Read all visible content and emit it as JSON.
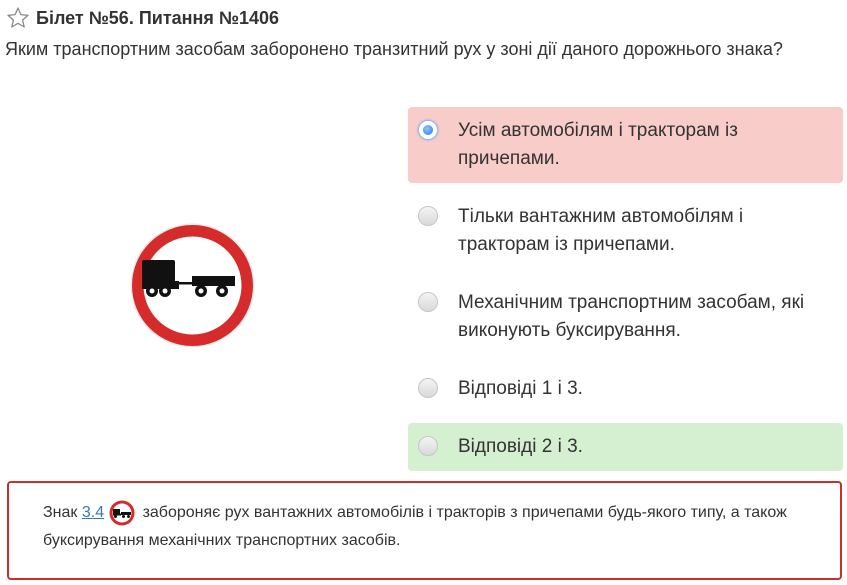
{
  "header": {
    "title": "Білет №56. Питання №1406"
  },
  "question": "Яким транспортним засобам заборонено транзитний рух у зоні дії даного дорожнього знака?",
  "answers": [
    {
      "text": "Усім автомобілям і тракторам із причепами.",
      "state": "wrong",
      "selected": true
    },
    {
      "text": "Тільки вантажним автомобілям і тракторам із причепами.",
      "state": "neutral",
      "selected": false
    },
    {
      "text": "Механічним транспортним засобам, які виконують буксирування.",
      "state": "neutral",
      "selected": false
    },
    {
      "text": "Відповіді 1 і 3.",
      "state": "neutral",
      "selected": false
    },
    {
      "text": "Відповіді 2 і 3.",
      "state": "right",
      "selected": false
    }
  ],
  "explanation": {
    "prefix": "Знак",
    "link_text": "3.4",
    "suffix": "забороняє рух вантажних автомобілів і тракторів з причепами будь-якого типу, а також буксирування механічних транспортних засобів."
  },
  "colors": {
    "wrong_bg": "#f8ccc8",
    "right_bg": "#d4f0d0",
    "border_red": "#c9302c",
    "link": "#337ab7",
    "sign_red": "#d52b2b"
  },
  "icons": {
    "favorite": "star-outline-icon",
    "sign": "no-trucks-with-trailers-sign"
  }
}
